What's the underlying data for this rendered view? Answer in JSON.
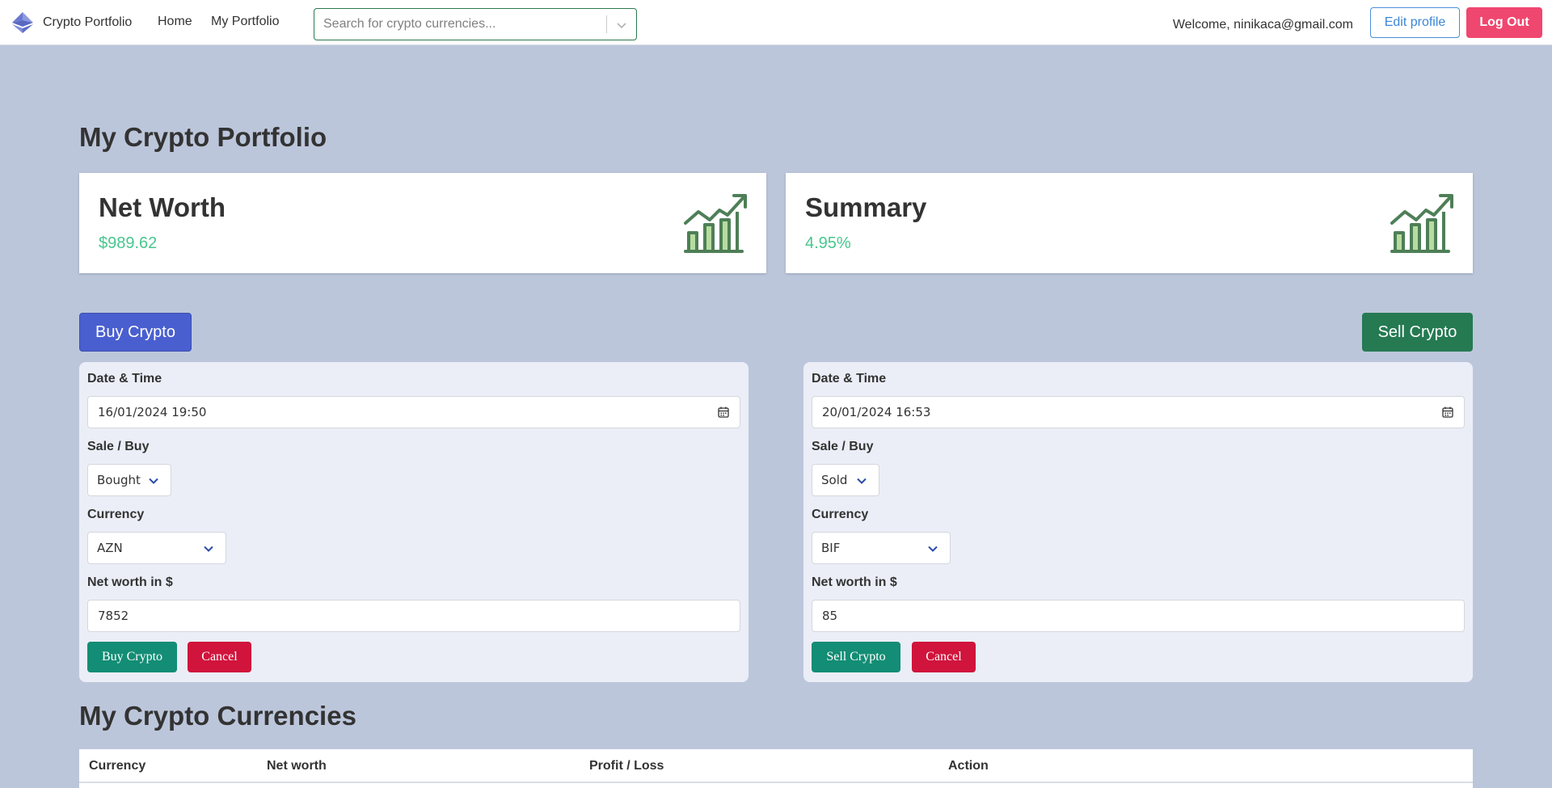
{
  "navbar": {
    "brand": "Crypto Portfolio",
    "links": [
      "Home",
      "My Portfolio"
    ],
    "search_placeholder": "Search for crypto currencies...",
    "welcome": "Welcome, ninikaca@gmail.com",
    "edit_profile": "Edit profile",
    "logout": "Log Out"
  },
  "page_title": "My Crypto Portfolio",
  "cards": {
    "net_worth": {
      "title": "Net Worth",
      "value": "$989.62"
    },
    "summary": {
      "title": "Summary",
      "value": "4.95%"
    }
  },
  "actions": {
    "buy": "Buy Crypto",
    "sell": "Sell Crypto"
  },
  "labels": {
    "date_time": "Date & Time",
    "sale_buy": "Sale / Buy",
    "currency": "Currency",
    "net_worth": "Net worth in $",
    "cancel": "Cancel"
  },
  "buy_form": {
    "date_time": "16/01/2024 19:50",
    "sale_buy": "Bought",
    "currency": "AZN",
    "net_worth": "7852",
    "submit": "Buy Crypto"
  },
  "sell_form": {
    "date_time": "20/01/2024 16:53",
    "sale_buy": "Sold",
    "currency": "BIF",
    "net_worth": "85",
    "submit": "Sell Crypto"
  },
  "currencies_title": "My Crypto Currencies",
  "table": {
    "columns": [
      "Currency",
      "Net worth",
      "Profit / Loss",
      "Action"
    ]
  },
  "colors": {
    "page_bg": "#bcc6db",
    "positive": "#48c78e",
    "buy_accent": "#4a5fcf",
    "sell_accent": "#257a52",
    "danger": "#d0143c",
    "logout": "#ef476f"
  },
  "icons": [
    "ethereum-logo-icon",
    "chevron-down-icon",
    "growth-chart-icon",
    "calendar-icon"
  ]
}
